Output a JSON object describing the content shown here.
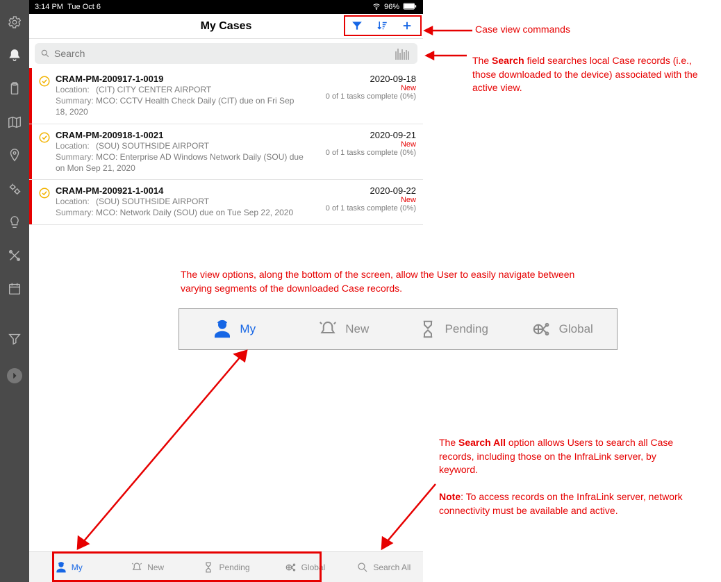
{
  "status": {
    "time": "3:14 PM",
    "date": "Tue Oct 6",
    "battery": "96%"
  },
  "title": "My Cases",
  "search": {
    "placeholder": "Search"
  },
  "cases": [
    {
      "id": "CRAM-PM-200917-1-0019",
      "location": "(CIT) CITY CENTER AIRPORT",
      "summary": "MCO: CCTV Health Check Daily (CIT) due on Fri Sep 18, 2020",
      "date": "2020-09-18",
      "status": "New",
      "tasks": "0 of 1 tasks complete (0%)"
    },
    {
      "id": "CRAM-PM-200918-1-0021",
      "location": "(SOU) SOUTHSIDE AIRPORT",
      "summary": "MCO: Enterprise AD Windows Network Daily (SOU) due on Mon Sep 21, 2020",
      "date": "2020-09-21",
      "status": "New",
      "tasks": "0 of 1 tasks complete (0%)"
    },
    {
      "id": "CRAM-PM-200921-1-0014",
      "location": "(SOU) SOUTHSIDE AIRPORT",
      "summary": "MCO: Network Daily (SOU) due on Tue Sep 22, 2020",
      "date": "2020-09-22",
      "status": "New",
      "tasks": "0 of 1 tasks complete (0%)"
    }
  ],
  "labels": {
    "location": "Location:",
    "summary": "Summary:"
  },
  "tabs": [
    {
      "label": "My"
    },
    {
      "label": "New"
    },
    {
      "label": "Pending"
    },
    {
      "label": "Global"
    },
    {
      "label": "Search All"
    }
  ],
  "annotations": {
    "cmds": "Case view commands",
    "search1a": "The ",
    "search1b": "Search",
    "search1c": " field searches local Case records (i.e., those downloaded to the device) associated with the active view.",
    "viewopts": "The view options, along the bottom of the screen, allow the User to easily navigate between varying segments of the downloaded Case records.",
    "sall1a": "The ",
    "sall1b": "Search All",
    "sall1c": " option allows Users to search all Case records, including those on the InfraLink server, by keyword.",
    "note_lbl": "Note",
    "note_txt": ": To access records on the InfraLink server, network connectivity must be available and active."
  }
}
